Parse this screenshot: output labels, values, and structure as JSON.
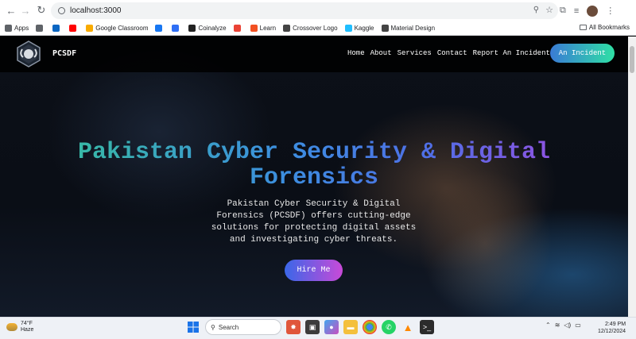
{
  "browser": {
    "url": "localhost:3000",
    "bookmarks": [
      {
        "label": "Apps",
        "icon": "apps-grid-icon",
        "color": "#5f6368"
      },
      {
        "label": "",
        "icon": "grid-icon",
        "color": "#5f6368"
      },
      {
        "label": "",
        "icon": "linkedin-icon",
        "color": "#0a66c2"
      },
      {
        "label": "",
        "icon": "youtube-icon",
        "color": "#ff0000"
      },
      {
        "label": "Google Classroom",
        "icon": "classroom-icon",
        "color": "#f9ab00"
      },
      {
        "label": "",
        "icon": "facebook-icon",
        "color": "#1877f2"
      },
      {
        "label": "",
        "icon": "messenger-icon",
        "color": "#2f6ff5"
      },
      {
        "label": "Coinalyze",
        "icon": "coinalyze-icon",
        "color": "#222222"
      },
      {
        "label": "",
        "icon": "gmail-icon",
        "color": "#ea4335"
      },
      {
        "label": "Learn",
        "icon": "microsoft-icon",
        "color": "#f25022"
      },
      {
        "label": "Crossover Logo",
        "icon": "globe-icon",
        "color": "#444444"
      },
      {
        "label": "Kaggle",
        "icon": "kaggle-icon",
        "color": "#20beff"
      },
      {
        "label": "Material Design",
        "icon": "globe-icon",
        "color": "#444444"
      }
    ],
    "all_bookmarks": "All Bookmarks"
  },
  "site": {
    "brand": "PCSDF",
    "nav": [
      "Home",
      "About",
      "Services",
      "Contact",
      "Report An Incident"
    ],
    "cta": "An Incident",
    "hero_title": "Pakistan Cyber Security & Digital Forensics",
    "hero_desc": "Pakistan Cyber Security & Digital Forensics (PCSDF) offers cutting-edge solutions for protecting digital assets and investigating cyber threats.",
    "hire_button": "Hire Me"
  },
  "taskbar": {
    "temp": "74°F",
    "condition": "Haze",
    "search_placeholder": "Search",
    "time": "2:49 PM",
    "date": "12/12/2024"
  }
}
